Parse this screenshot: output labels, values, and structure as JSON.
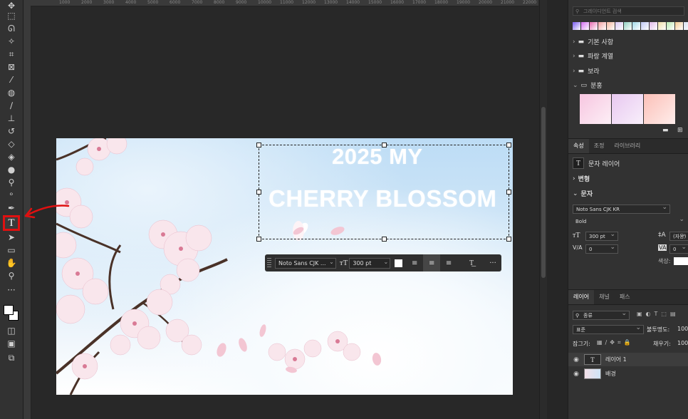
{
  "rulers": {
    "h_ticks": [
      "1000",
      "2000",
      "3000",
      "4000",
      "5000",
      "6000",
      "7000",
      "8000",
      "9000",
      "10000",
      "11000",
      "12000",
      "13000",
      "14000",
      "15000",
      "16000",
      "17000",
      "18000",
      "19000",
      "20000",
      "21000",
      "22000",
      "23000"
    ]
  },
  "document": {
    "title_line1": "2025 MY",
    "title_line2": "CHERRY BLOSSOM"
  },
  "context_bar": {
    "font": "Noto Sans CJK ...",
    "size": "300 pt",
    "more": "···"
  },
  "swatches": {
    "search_placeholder": "그레이디언트 검색",
    "colors": [
      "#7a5cf0",
      "#d46ef2",
      "#e86bb0",
      "#f3a0a0",
      "#f5b7a0",
      "#d9c8f5",
      "#8fd0c0",
      "#a0d8e8",
      "#c0c8f5",
      "#e0b8e8",
      "#f0e0a8",
      "#b8e8b0",
      "#f0c890",
      "#d8e0f0"
    ],
    "folders": [
      "기본 사항",
      "파랑 계열",
      "보라",
      "분홍"
    ],
    "thumbs": [
      "#f7c6e0",
      "#e8c8f0",
      "#fcc0b8"
    ]
  },
  "properties": {
    "tabs": [
      "속성",
      "조정",
      "라이브러리"
    ],
    "layer_type": "문자 레이어",
    "transform": "변형",
    "character": "문자",
    "font_family": "Noto Sans CJK KR",
    "font_style": "Bold",
    "size": "300 pt",
    "leading": "(자동)",
    "kerning": "0",
    "tracking": "0",
    "color_label": "색상:"
  },
  "layers_panel": {
    "tabs": [
      "레이어",
      "채널",
      "패스"
    ],
    "filter_label": "종류",
    "blend_mode": "표준",
    "opacity_label": "불투명도:",
    "opacity_value": "100%",
    "lock_label": "잠그기:",
    "fill_label": "채우기:",
    "fill_value": "100%",
    "layers": [
      {
        "name": "레이어 1",
        "type": "text"
      },
      {
        "name": "배경",
        "type": "image"
      }
    ]
  }
}
